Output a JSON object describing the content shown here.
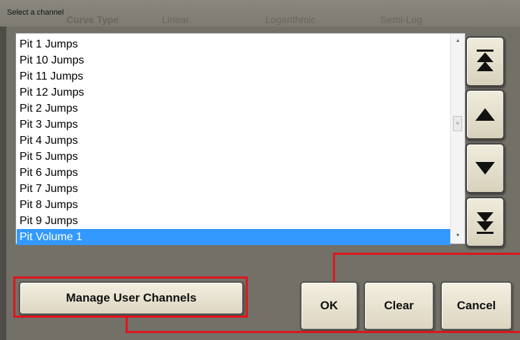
{
  "dialog": {
    "title": "Select a channel",
    "background_fragments": [
      "Curve Type",
      "Linear",
      "Logarithmic",
      "Semi-Log"
    ]
  },
  "channel_list": {
    "items": [
      "Pit 1 Jumps",
      "Pit 10 Jumps",
      "Pit 11 Jumps",
      "Pit 12 Jumps",
      "Pit 2 Jumps",
      "Pit 3 Jumps",
      "Pit 4 Jumps",
      "Pit 5 Jumps",
      "Pit 6 Jumps",
      "Pit 7 Jumps",
      "Pit 8 Jumps",
      "Pit 9 Jumps",
      "Pit Volume 1"
    ],
    "selected": "Pit Volume 1"
  },
  "nav_buttons": {
    "top": "double-up-arrow-icon",
    "up": "up-arrow-icon",
    "down": "down-arrow-icon",
    "bottom": "double-down-arrow-icon"
  },
  "buttons": {
    "manage": "Manage User Channels",
    "ok": "OK",
    "clear": "Clear",
    "cancel": "Cancel"
  },
  "colors": {
    "selection": "#3399ff",
    "highlight": "#e0141c",
    "dialog_bg": "#737068"
  }
}
